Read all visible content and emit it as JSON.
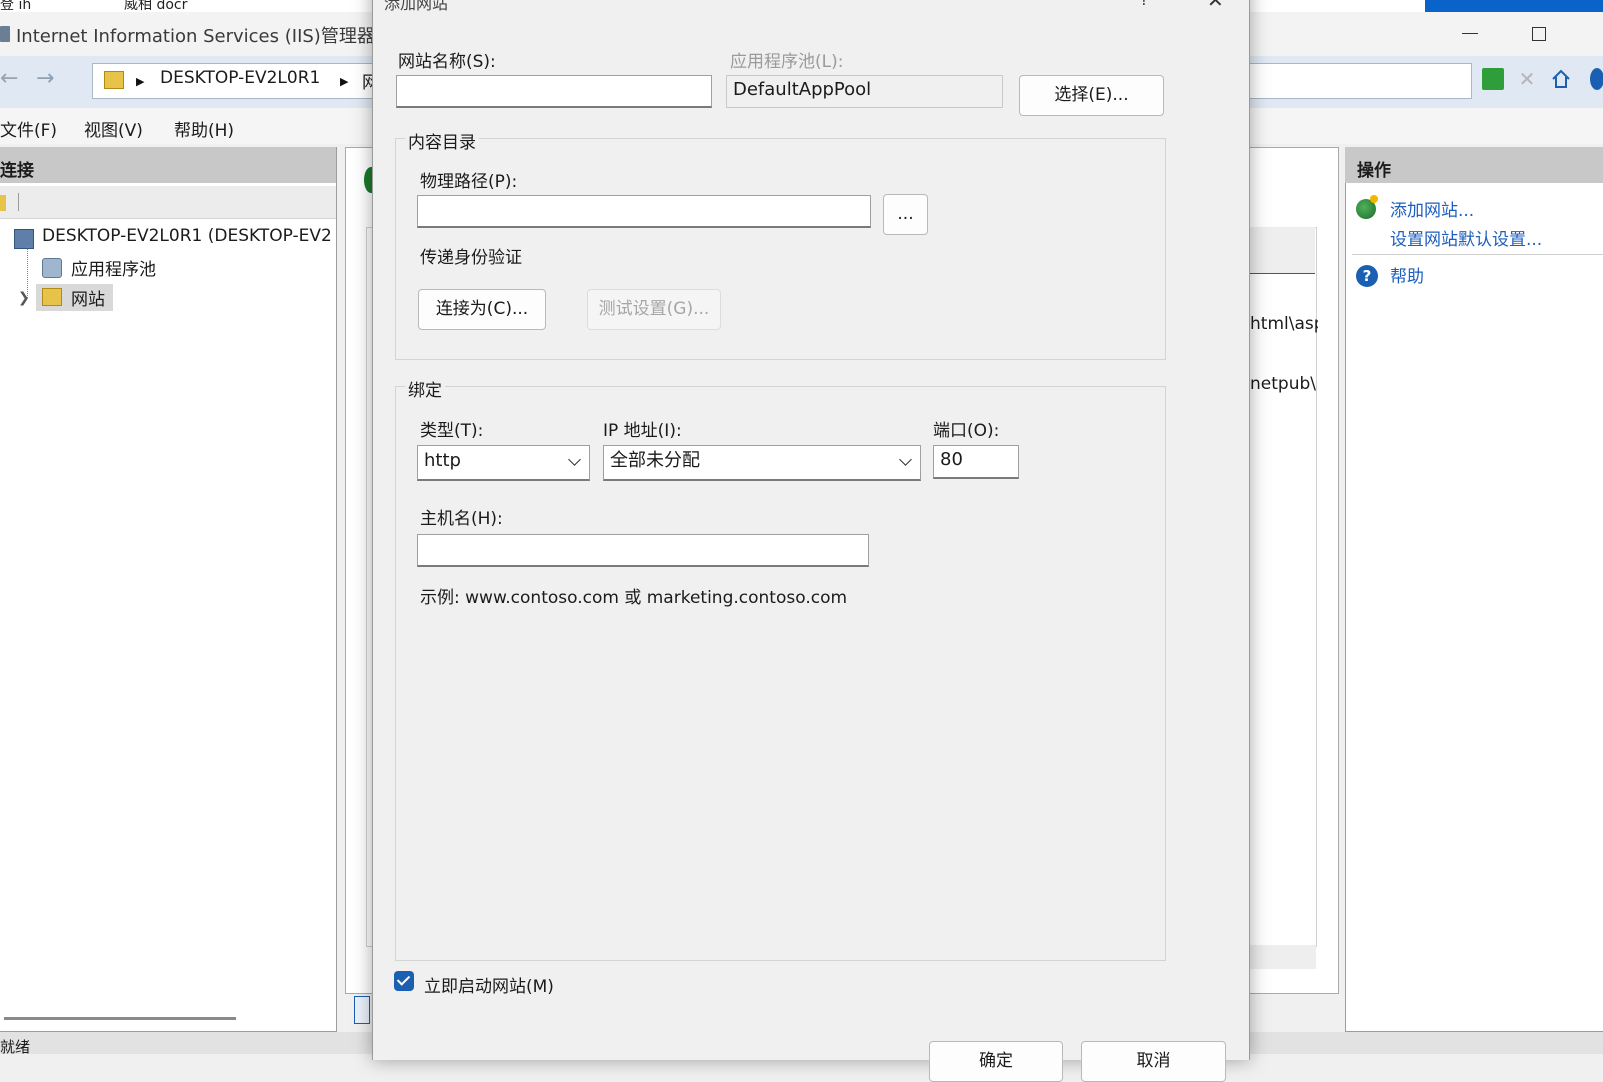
{
  "taskbar": {
    "item1": "登 ih",
    "item2": "威相 docr"
  },
  "window": {
    "title": "Internet Information Services (IIS)管理器"
  },
  "address": {
    "crumb1": "DESKTOP-EV2L0R1",
    "crumb2_frag": "网"
  },
  "menu": {
    "file": "文件(F)",
    "view": "视图(V)",
    "help": "帮助(H)"
  },
  "connections": {
    "title": "连接",
    "server": "DESKTOP-EV2L0R1 (DESKTOP-EV2",
    "app_pools": "应用程序池",
    "sites": "网站"
  },
  "center": {
    "frag1": "html\\asp",
    "frag2": "netpub\\"
  },
  "actions": {
    "title": "操作",
    "add_site": "添加网站...",
    "set_defaults": "设置网站默认设置...",
    "help": "帮助"
  },
  "status": {
    "text": "就绪"
  },
  "dialog": {
    "title": "添加网站",
    "help_mark": "?",
    "close": "✕",
    "site_name_label": "网站名称(S):",
    "site_name_value": "",
    "app_pool_label": "应用程序池(L):",
    "app_pool_value": "DefaultAppPool",
    "select_button": "选择(E)...",
    "content_dir": {
      "title": "内容目录",
      "physical_path_label": "物理路径(P):",
      "physical_path_value": "",
      "browse_button": "...",
      "pass_through_label": "传递身份验证",
      "connect_as_button": "连接为(C)...",
      "test_settings_button": "测试设置(G)..."
    },
    "binding": {
      "title": "绑定",
      "type_label": "类型(T):",
      "type_value": "http",
      "ip_label": "IP 地址(I):",
      "ip_value": "全部未分配",
      "port_label": "端口(O):",
      "port_value": "80",
      "host_label": "主机名(H):",
      "host_value": "",
      "example": "示例: www.contoso.com 或 marketing.contoso.com"
    },
    "start_immediately_label": "立即启动网站(M)",
    "start_immediately_checked": true,
    "ok_button": "确定",
    "cancel_button": "取消"
  }
}
